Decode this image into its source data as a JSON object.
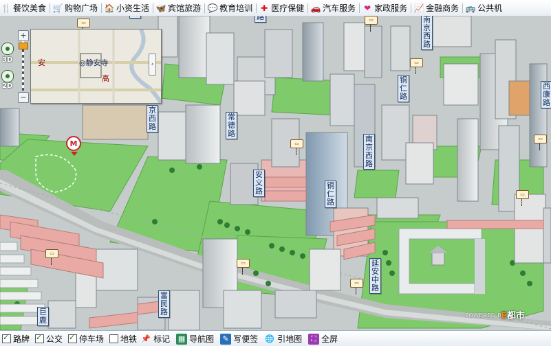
{
  "categories": [
    {
      "icon": "fork-knife-icon",
      "glyph": "🍴",
      "label": "餐饮美食"
    },
    {
      "icon": "shopping-cart-icon",
      "glyph": "🛒",
      "label": "购物广场"
    },
    {
      "icon": "house-icon",
      "glyph": "🏠",
      "label": "小资生活"
    },
    {
      "icon": "butterfly-icon",
      "glyph": "🦋",
      "label": "宾馆旅游"
    },
    {
      "icon": "speech-bubble-icon",
      "glyph": "💬",
      "label": "教育培训"
    },
    {
      "icon": "red-cross-icon",
      "glyph": "✚",
      "label": "医疗保健"
    },
    {
      "icon": "car-icon",
      "glyph": "🚗",
      "label": "汽车服务"
    },
    {
      "icon": "heart-icon",
      "glyph": "❤",
      "label": "家政服务"
    },
    {
      "icon": "chart-icon",
      "glyph": "📈",
      "label": "金融商务"
    },
    {
      "icon": "bus-icon",
      "glyph": "🚌",
      "label": "公共机"
    }
  ],
  "minimap": {
    "place": "◎静安寺",
    "left_char": "安",
    "right_char": "高"
  },
  "nav": {
    "mode_3d": "3D",
    "mode_2d": "2D",
    "zoom_in": "+",
    "zoom_out": "−",
    "collapse": "‹"
  },
  "road_labels": [
    {
      "id": "nanjing-xi-top",
      "text": "南京西路"
    },
    {
      "id": "jing-xi",
      "text": "京西路"
    },
    {
      "id": "changde",
      "text": "常德路"
    },
    {
      "id": "anyi",
      "text": "安义路"
    },
    {
      "id": "tongren-mid",
      "text": "铜仁路"
    },
    {
      "id": "nanjing-xi-mid",
      "text": "南京西路"
    },
    {
      "id": "tongren-top",
      "text": "铜仁路"
    },
    {
      "id": "top-left-fragment",
      "text": "南"
    },
    {
      "id": "top-center",
      "text": "路"
    },
    {
      "id": "right-edge",
      "text": "西康路"
    },
    {
      "id": "yanan-zhong",
      "text": "延安中路"
    },
    {
      "id": "fumin",
      "text": "富民路"
    },
    {
      "id": "julu",
      "text": "巨鹿"
    }
  ],
  "metro_label": "M",
  "powered_by": "POWERED BY",
  "brand": {
    "prefix": "E",
    "name": "都市"
  },
  "toolbar": {
    "checks": [
      {
        "label": "路牌",
        "checked": true
      },
      {
        "label": "公交",
        "checked": true
      },
      {
        "label": "停车场",
        "checked": true
      },
      {
        "label": "地铁",
        "checked": false
      }
    ],
    "tools": [
      {
        "icon": "pin-icon",
        "glyph": "📌",
        "label": "标记"
      },
      {
        "icon": "navigator-icon",
        "glyph": "▦",
        "label": "导航图"
      },
      {
        "icon": "memo-icon",
        "glyph": "✎",
        "label": "写便签"
      },
      {
        "icon": "link-icon",
        "glyph": "🌐",
        "label": "引地图"
      },
      {
        "icon": "fullscreen-icon",
        "glyph": "⛶",
        "label": "全屏"
      }
    ]
  },
  "colors": {
    "grass": "#7cc76a",
    "road": "#c4c9c8",
    "roof_red": "#e8a6a2",
    "building": "#d9dcdc",
    "label_bg": "#dfe8f6"
  }
}
